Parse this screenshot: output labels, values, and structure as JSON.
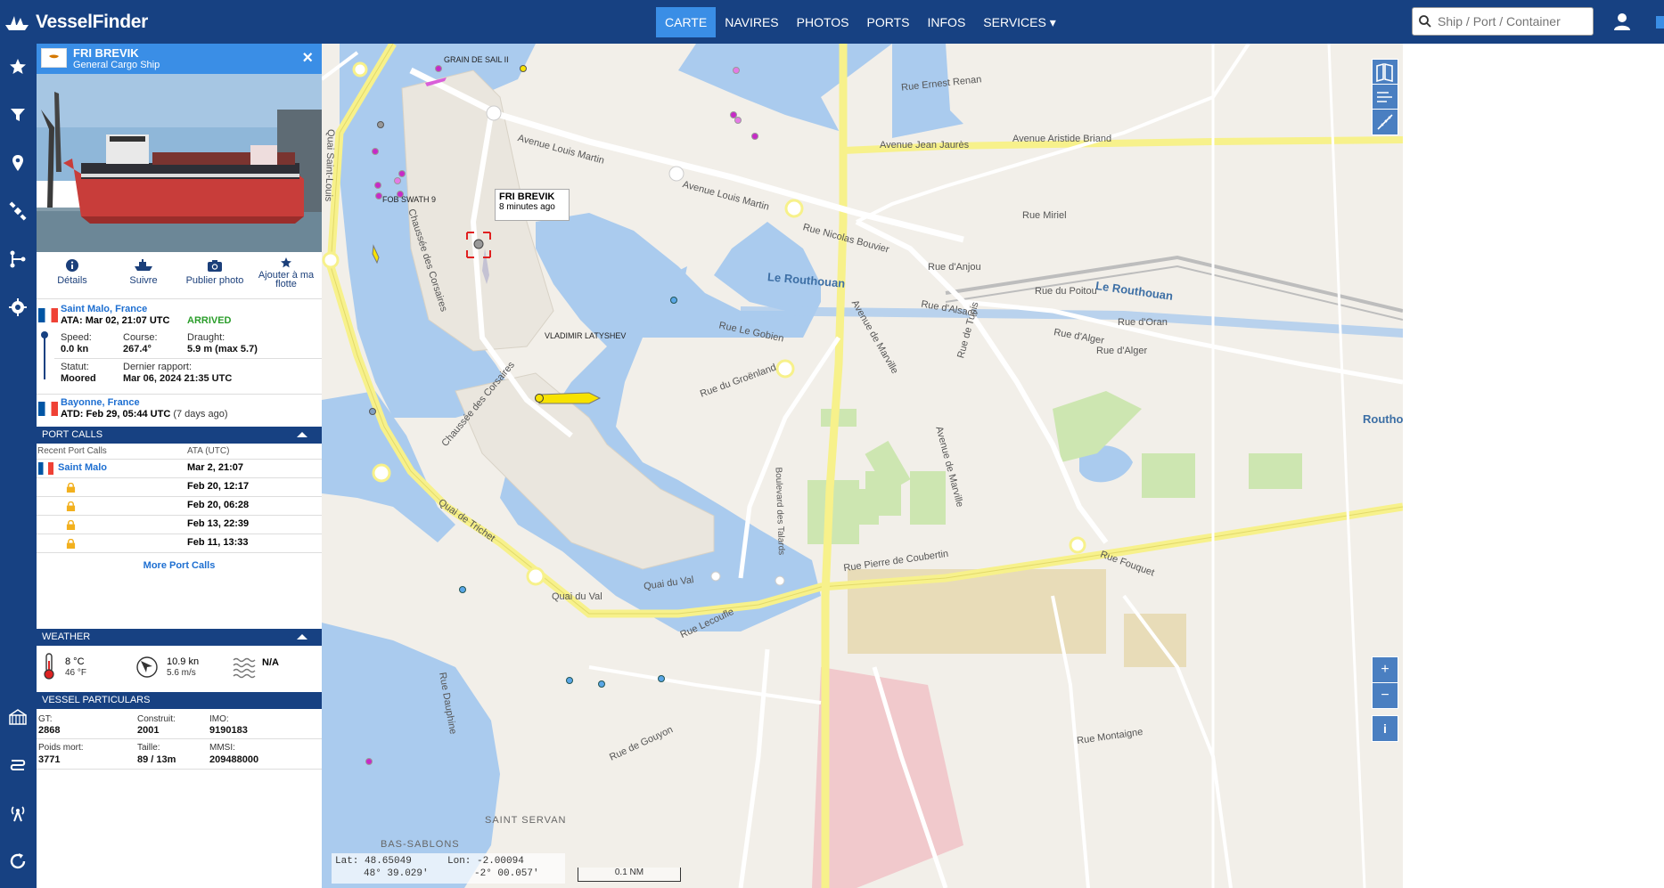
{
  "app": {
    "logo_text": "VesselFinder",
    "logo_icon": "ship-logo-icon"
  },
  "nav": {
    "items": [
      {
        "label": "CARTE",
        "active": true
      },
      {
        "label": "NAVIRES"
      },
      {
        "label": "PHOTOS"
      },
      {
        "label": "PORTS"
      },
      {
        "label": "INFOS"
      },
      {
        "label": "SERVICES ▾"
      }
    ]
  },
  "search": {
    "placeholder": "Ship / Port / Container",
    "icon": "search-icon"
  },
  "rail_icons": [
    "star-icon",
    "filter-icon",
    "pin-icon",
    "satellite-icon",
    "route-icon",
    "gear-icon",
    "port-icon",
    "lines-icon",
    "antenna-icon",
    "refresh-icon"
  ],
  "ship": {
    "name": "FRI BREVIK",
    "type": "General Cargo Ship",
    "flag": "Cyprus"
  },
  "actions": [
    {
      "label": "Détails",
      "icon": "info-icon"
    },
    {
      "label": "Suivre",
      "icon": "ship-follow-icon"
    },
    {
      "label": "Publier photo",
      "icon": "camera-icon"
    },
    {
      "label": "Ajouter à ma flotte",
      "icon": "star-icon"
    }
  ],
  "voyage": {
    "dest_port": "Saint Malo, France",
    "ata": "ATA: Mar 02, 21:07 UTC",
    "status_badge": "ARRIVED",
    "speed_label": "Speed:",
    "speed_val": "0.0 kn",
    "course_label": "Course:",
    "course_val": "267.4°",
    "draught_label": "Draught:",
    "draught_val": "5.9 m (max 5.7)",
    "statut_label": "Statut:",
    "statut_val": "Moored",
    "rapport_label": "Dernier rapport:",
    "rapport_val": "Mar 06, 2024 21:35 UTC",
    "origin_port": "Bayonne, France",
    "atd": "ATD: Feb 29, 05:44 UTC",
    "atd_ago": "(7 days ago)"
  },
  "port_calls": {
    "title": "PORT CALLS",
    "col1": "Recent Port Calls",
    "col2": "ATA (UTC)",
    "rows": [
      {
        "port": "Saint Malo",
        "date": "Mar 2, 21:07"
      },
      {
        "port": "",
        "date": "Feb 20, 12:17"
      },
      {
        "port": "",
        "date": "Feb 20, 06:28"
      },
      {
        "port": "",
        "date": "Feb 13, 22:39"
      },
      {
        "port": "",
        "date": "Feb 11, 13:33"
      }
    ],
    "more": "More Port Calls"
  },
  "weather": {
    "title": "WEATHER",
    "temp_c": "8 °C",
    "temp_f": "46 °F",
    "wind_kn": "10.9 kn",
    "wind_ms": "5.6 m/s",
    "waves": "N/A"
  },
  "particulars": {
    "title": "VESSEL PARTICULARS",
    "gt_label": "GT:",
    "gt": "2868",
    "built_label": "Construit:",
    "built": "2001",
    "imo_label": "IMO:",
    "imo": "9190183",
    "dwt_label": "Poids mort:",
    "dwt": "3771",
    "size_label": "Taille:",
    "size": "89 / 13m",
    "mmsi_label": "MMSI:",
    "mmsi": "209488000"
  },
  "map": {
    "tooltip_name": "FRI BREVIK",
    "tooltip_time": "8 minutes ago",
    "labels": {
      "grain": "GRAIN DE SAIL II",
      "fob": "FOB SWATH 9",
      "vladimir": "VLADIMIR LATYSHEV",
      "louis_martin": "Avenue Louis Martin",
      "louis_martin2": "Avenue Louis Martin",
      "jean_jaures": "Avenue Jean Jaurès",
      "aristide": "Avenue Aristide Briand",
      "ernest": "Rue Ernest Renan",
      "routhouan": "Le Routhouan",
      "routhouan2": "Le Routhouan",
      "routhouan3": "Routho",
      "corsaires": "Chaussée des Corsaires",
      "corsaires2": "Chaussée des Corsaires",
      "triquet": "Quai de Trichet",
      "quai_val": "Quai du Val",
      "quai_val2": "Quai du Val",
      "coubertin": "Rue Pierre de Coubertin",
      "tabarly": "Boulevard des Talards",
      "saint_servan": "SAINT SERVAN",
      "bas_sablons": "BAS-SABLONS",
      "alsace": "Rue d'Alsace",
      "alger": "Rue d'Alger",
      "alger2": "Rue d'Alger",
      "anjou": "Rue d'Anjou",
      "poitou": "Rue du Poitou",
      "oran": "Rue d'Oran",
      "marville": "Avenue de Marville",
      "marville2": "Avenue de Marville",
      "nicolas": "Rue Nicolas Bouvier",
      "gobien": "Rue Le Gobien",
      "groenland": "Rue du Groënland",
      "tunis": "Rue de Tunis",
      "miriel": "Rue Miriel",
      "fouquet": "Rue Fouquet",
      "montaigne": "Rue Montaigne",
      "lecoufle": "Rue Lecoufle",
      "gouyon": "Rue de Gouyon",
      "dauphine": "Rue Dauphine",
      "quai_st_louis": "Quai Saint-Louis"
    },
    "coords_lat": "Lat: 48.65049",
    "coords_lat_dms": "48° 39.029'",
    "coords_lon": "Lon: -2.00094",
    "coords_lon_dms": "-2° 00.057'",
    "scale": "0.1 NM",
    "zoom_in": "+",
    "zoom_out": "−",
    "info": "i"
  },
  "colors": {
    "brand": "#174182",
    "accent": "#3a8ee6",
    "water": "#aacbee",
    "road": "#f7f18b",
    "arrived": "#2a9d2a"
  }
}
